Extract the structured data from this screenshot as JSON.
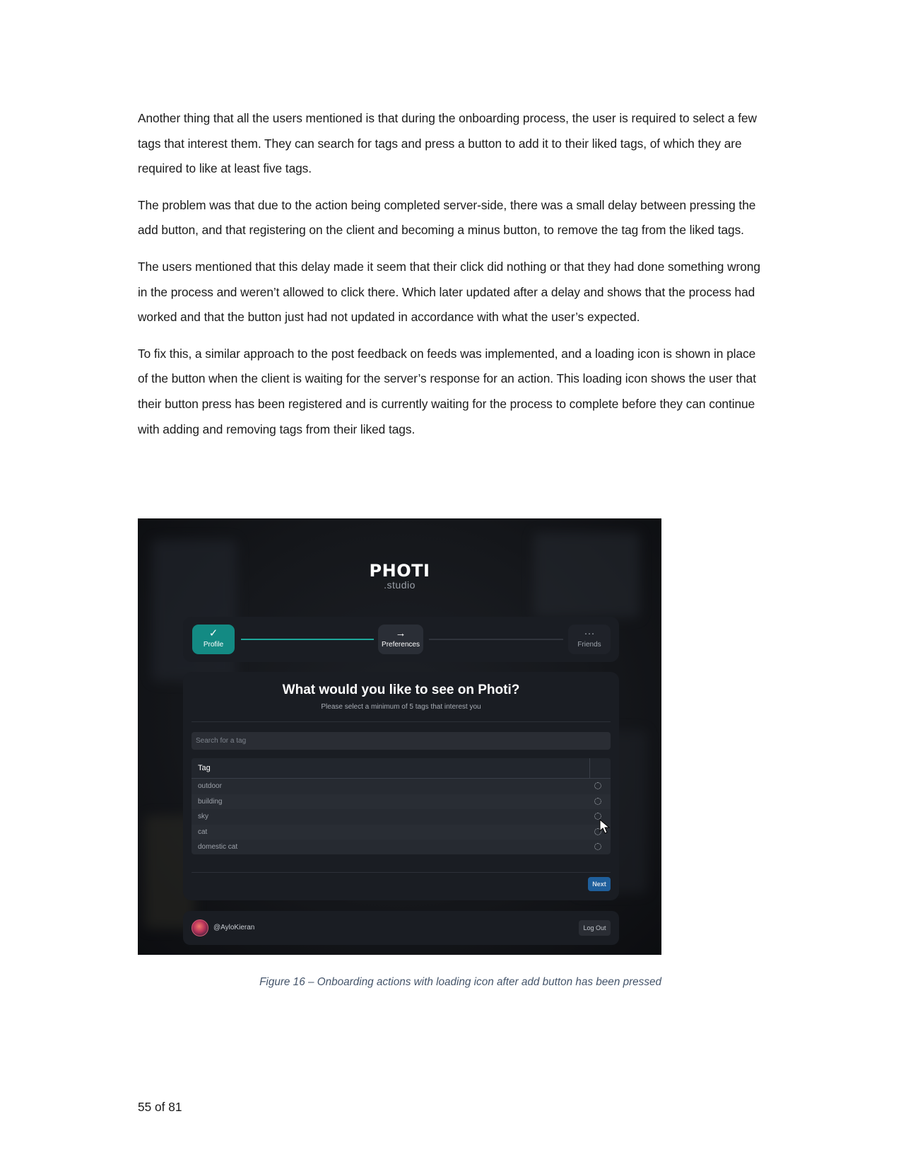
{
  "paragraphs": [
    "Another thing that all the users mentioned is that during the onboarding process, the user is required to select a few tags that interest them. They can search for tags and press a button to add it to their liked tags, of which they are required to like at least five tags.",
    "The problem was that due to the action being completed server-side, there was a small delay between pressing the add button, and that registering on the client and becoming a minus button, to remove the tag from the liked tags.",
    "The users mentioned that this delay made it seem that their click did nothing or that they had done something wrong in the process and weren’t allowed to click there. Which later updated after a delay and shows that the process had worked and that the button just had not updated in accordance with what the user’s expected.",
    "To fix this, a similar approach to the post feedback on feeds was implemented, and a loading icon is shown in place of the button when the client is waiting for the server’s response for an action. This loading icon shows the user that their button press has been registered and is currently waiting for the process to complete before they can continue with adding and removing tags from their liked tags."
  ],
  "screenshot": {
    "logo_title": "PHOTI",
    "logo_subtitle": ".studio",
    "steps": [
      {
        "label": "Profile",
        "icon": "check-icon",
        "state": "complete"
      },
      {
        "label": "Preferences",
        "icon": "arrow-right-icon",
        "state": "current"
      },
      {
        "label": "Friends",
        "icon": "ellipsis-icon",
        "state": "upcoming"
      }
    ],
    "heading": "What would you like to see on Photi?",
    "subheading": "Please select a minimum of 5 tags that interest you",
    "search_placeholder": "Search for a tag",
    "table_header": "Tag",
    "tags": [
      "outdoor",
      "building",
      "sky",
      "cat",
      "domestic cat"
    ],
    "row_action_icon": "loading-spinner-icon",
    "next_label": "Next",
    "username": "@AyloKieran",
    "logout_label": "Log Out",
    "colors": {
      "accent_teal": "#138a83",
      "next_blue": "#1f5f9c",
      "panel": "#1a1d23"
    }
  },
  "caption": "Figure 16 – Onboarding actions with loading icon after add button has been pressed",
  "page_number": "55 of 81"
}
